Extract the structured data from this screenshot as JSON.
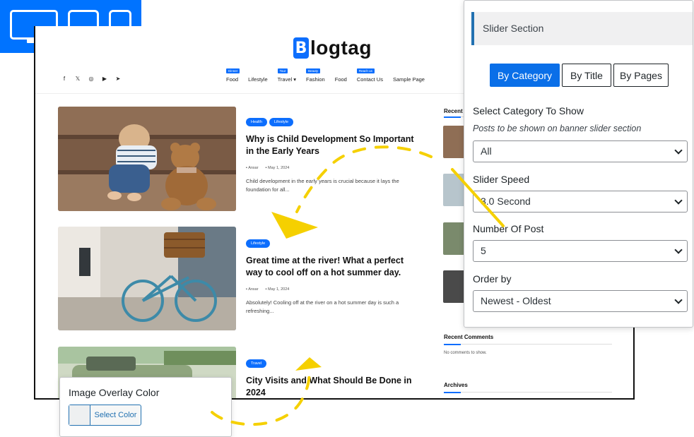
{
  "site": {
    "logo_text": "logtag",
    "logo_mark": "B",
    "social_icons": [
      "facebook-icon",
      "x-icon",
      "instagram-icon",
      "youtube-icon",
      "telegram-icon"
    ],
    "nav": [
      {
        "label": "Food",
        "badge": "Dinner"
      },
      {
        "label": "Lifestyle",
        "badge": ""
      },
      {
        "label": "Travel ▾",
        "badge": "Tour"
      },
      {
        "label": "Fashion",
        "badge": "Beauty"
      },
      {
        "label": "Food",
        "badge": ""
      },
      {
        "label": "Contact Us",
        "badge": "Reach us"
      },
      {
        "label": "Sample Page",
        "badge": ""
      }
    ],
    "posts": [
      {
        "tags": [
          "Health",
          "Lifestyle"
        ],
        "title": "Why is Child Development So Important in the Early Years",
        "author": "Ansar",
        "date": "May 1, 2024",
        "excerpt": "Child development in the early years is crucial because it lays the foundation for all..."
      },
      {
        "tags": [
          "Lifestyle"
        ],
        "title": "Great time at the river! What a perfect way to cool off on a hot summer day.",
        "author": "Ansar",
        "date": "May 1, 2024",
        "excerpt": "Absolutely! Cooling off at the river on a hot summer day is such a refreshing..."
      },
      {
        "tags": [
          "Travel"
        ],
        "title": "City Visits and What Should Be Done in 2024"
      }
    ],
    "sidebar": {
      "recent_title": "Recent",
      "comments_title": "Recent Comments",
      "comments_text": "No comments to show.",
      "archives_title": "Archives"
    }
  },
  "panel": {
    "header": "Slider Section",
    "tabs": [
      "By Category",
      "By Title",
      "By Pages"
    ],
    "active_tab": "By Category",
    "category_label": "Select Category To Show",
    "category_help": "Posts to be shown on banner slider section",
    "category_value": "All",
    "speed_label": "Slider Speed",
    "speed_value": "3.0 Second",
    "number_label": "Number Of Post",
    "number_value": "5",
    "order_label": "Order by",
    "order_value": "Newest - Oldest",
    "accent_color": "#0a6fe8"
  },
  "overlay": {
    "label": "Image Overlay Color",
    "button_label": "Select Color"
  },
  "colors": {
    "brand_blue": "#0073ff",
    "arrow_yellow": "#f5d000"
  }
}
